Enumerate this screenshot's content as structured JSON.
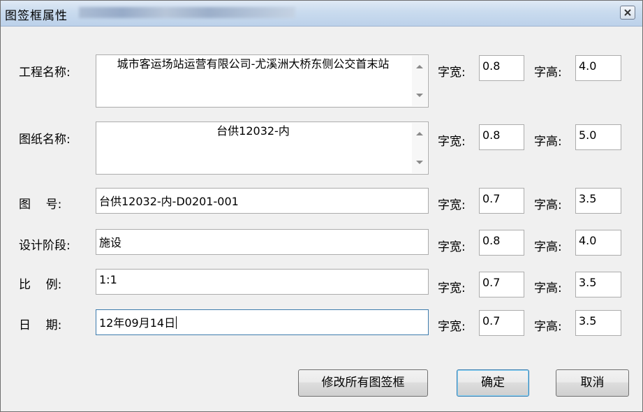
{
  "window": {
    "title": "图签框属性",
    "title_obscured": true
  },
  "colors": {
    "dialog_bg": "#f0f0f0",
    "field_border": "#acacac",
    "focus_border": "#3d7bad",
    "default_button_border": "#3c7fb1"
  },
  "rows": [
    {
      "label": "工程名称:",
      "value": "城市客运场站运营有限公司-尤溪洲大桥东侧公交首末站",
      "width_label": "字宽:",
      "width_value": "0.8",
      "height_label": "字高:",
      "height_value": "4.0",
      "multiline": true
    },
    {
      "label": "图纸名称:",
      "value": "台供12032-内",
      "width_label": "字宽:",
      "width_value": "0.8",
      "height_label": "字高:",
      "height_value": "5.0",
      "multiline": true
    },
    {
      "label": "图    号:",
      "value": "台供12032-内-D0201-001",
      "width_label": "字宽:",
      "width_value": "0.7",
      "height_label": "字高:",
      "height_value": "3.5"
    },
    {
      "label": "设计阶段:",
      "value": "施设",
      "width_label": "字宽:",
      "width_value": "0.8",
      "height_label": "字高:",
      "height_value": "4.0"
    },
    {
      "label": "比    例:",
      "value": "1:1",
      "width_label": "字宽:",
      "width_value": "0.7",
      "height_label": "字高:",
      "height_value": "3.5"
    },
    {
      "label": "日    期:",
      "value": "12年09月14日",
      "width_label": "字宽:",
      "width_value": "0.7",
      "height_label": "字高:",
      "height_value": "3.5",
      "focused": true
    }
  ],
  "buttons": {
    "modify_all": "修改所有图签框",
    "ok": "确定",
    "cancel": "取消"
  },
  "icons": {
    "close": "close-icon",
    "scroll_up": "scroll-up-arrow-icon",
    "scroll_down": "scroll-down-arrow-icon"
  }
}
